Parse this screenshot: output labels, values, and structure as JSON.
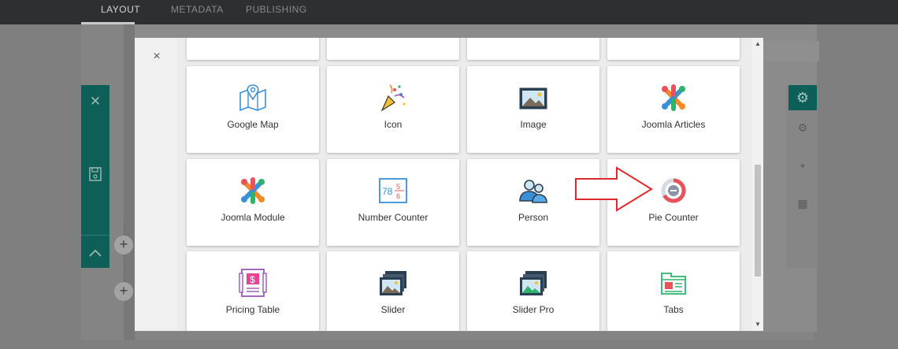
{
  "topbar": {
    "tabs": [
      {
        "label": "LAYOUT",
        "active": true
      },
      {
        "label": "METADATA",
        "active": false
      },
      {
        "label": "PUBLISHING",
        "active": false
      }
    ]
  },
  "modal": {
    "close_icon": "×",
    "addons": [
      {
        "label": "",
        "icon": "partial-card"
      },
      {
        "label": "",
        "icon": "partial-card"
      },
      {
        "label": "",
        "icon": "partial-card"
      },
      {
        "label": "",
        "icon": "partial-card"
      },
      {
        "label": "Google Map",
        "icon": "map-icon"
      },
      {
        "label": "Icon",
        "icon": "party-popper-icon"
      },
      {
        "label": "Image",
        "icon": "image-icon"
      },
      {
        "label": "Joomla Articles",
        "icon": "joomla-icon"
      },
      {
        "label": "Joomla Module",
        "icon": "joomla-icon"
      },
      {
        "label": "Number Counter",
        "icon": "number-counter-icon"
      },
      {
        "label": "Person",
        "icon": "person-icon"
      },
      {
        "label": "Pie Counter",
        "icon": "pie-counter-icon"
      },
      {
        "label": "Pricing Table",
        "icon": "pricing-table-icon"
      },
      {
        "label": "Slider",
        "icon": "slider-icon"
      },
      {
        "label": "Slider Pro",
        "icon": "slider-pro-icon"
      },
      {
        "label": "Tabs",
        "icon": "tabs-icon"
      }
    ],
    "number_counter_digits": {
      "left": "78",
      "right_top": "5",
      "right_bottom": "6"
    },
    "pricing_symbol": "$"
  },
  "colors": {
    "teal": "#0e5f57",
    "highlight_arrow": "#e0292c",
    "pie_ring": "#e8535b"
  }
}
